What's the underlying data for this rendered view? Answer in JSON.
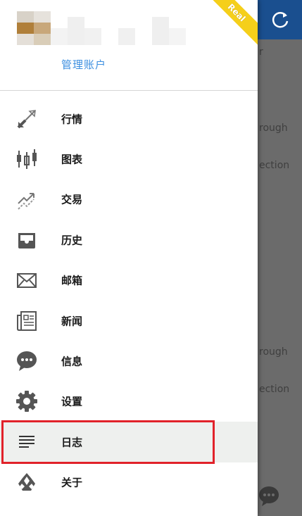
{
  "background": {
    "texts": [
      "r",
      "rough",
      "ection",
      "rough",
      "ection"
    ]
  },
  "header": {
    "manage_account_label": "管理账户",
    "ribbon_label": "Real"
  },
  "menu": {
    "items": [
      {
        "label": "行情",
        "icon": "quotes-arrows-icon"
      },
      {
        "label": "图表",
        "icon": "candlestick-chart-icon"
      },
      {
        "label": "交易",
        "icon": "trade-icon"
      },
      {
        "label": "历史",
        "icon": "inbox-history-icon"
      },
      {
        "label": "邮箱",
        "icon": "mail-icon"
      },
      {
        "label": "新闻",
        "icon": "newspaper-icon"
      },
      {
        "label": "信息",
        "icon": "chat-bubble-icon"
      },
      {
        "label": "设置",
        "icon": "gear-icon"
      },
      {
        "label": "日志",
        "icon": "journal-lines-icon"
      },
      {
        "label": "关于",
        "icon": "about-logo-icon"
      }
    ],
    "selected": "日志"
  },
  "colors": {
    "accent": "#3d8fe0",
    "topbar": "#1a4f8f",
    "ribbon": "#f5cf1a",
    "highlight": "#e1222a"
  }
}
